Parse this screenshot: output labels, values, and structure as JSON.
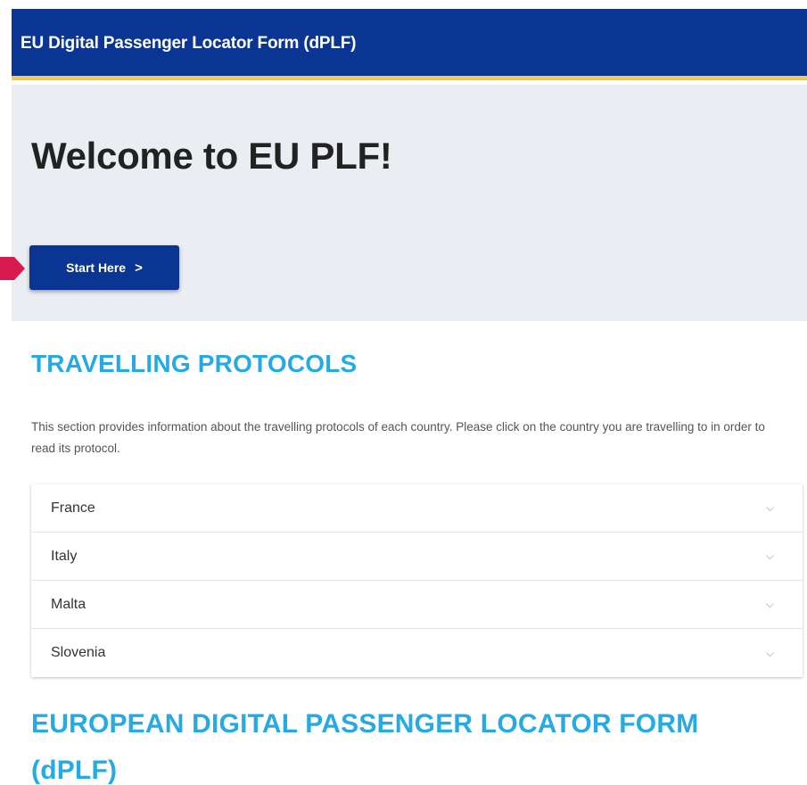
{
  "header": {
    "title": "EU Digital Passenger Locator Form (dPLF)"
  },
  "hero": {
    "title": "Welcome to EU PLF!",
    "start_button": {
      "label": "Start Here",
      "chevron": ">"
    }
  },
  "protocols": {
    "title": "TRAVELLING PROTOCOLS",
    "description": "This section provides information about the travelling protocols of each country. Please click on the country you are travelling to in order to read its protocol.",
    "countries": [
      {
        "label": "France",
        "icon": "chevron-down-icon"
      },
      {
        "label": "Italy",
        "icon": "chevron-down-icon"
      },
      {
        "label": "Malta",
        "icon": "chevron-down-icon"
      },
      {
        "label": "Slovenia",
        "icon": "chevron-down-icon"
      }
    ]
  },
  "dplf_section": {
    "title": "EUROPEAN DIGITAL PASSENGER LOCATOR FORM (dPLF)"
  },
  "colors": {
    "brand_blue": "#0b3592",
    "accent_yellow": "#f2c94c",
    "section_title_blue": "#27aae1",
    "hero_background": "#eaedf1",
    "pointer_arrow": "#d81b4f"
  }
}
